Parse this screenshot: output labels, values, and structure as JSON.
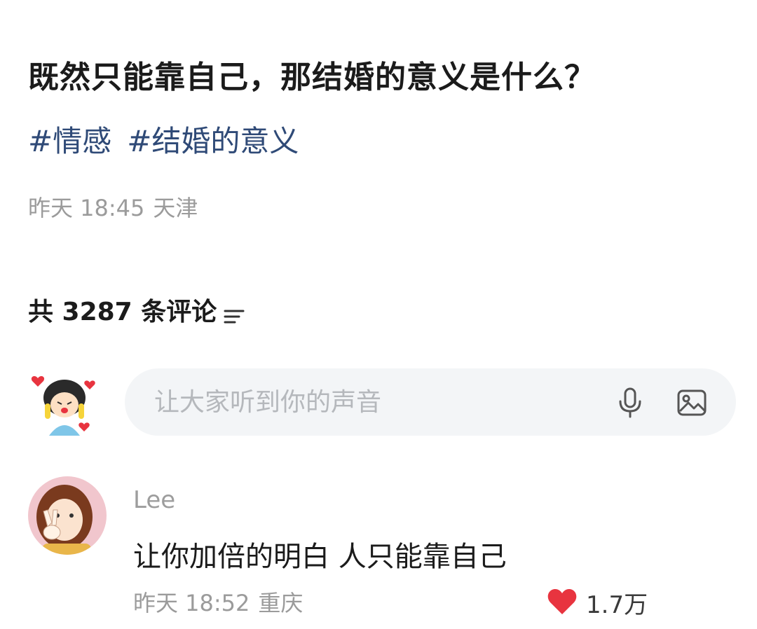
{
  "post": {
    "title": "既然只能靠自己，那结婚的意义是什么？",
    "tags": [
      "#情感",
      "#结婚的意义"
    ],
    "time": "昨天 18:45",
    "location": "天津"
  },
  "comments_header": {
    "label": "共 3287 条评论",
    "sort_icon": "sort-icon"
  },
  "composer": {
    "placeholder": "让大家听到你的声音",
    "mic_icon": "microphone-icon",
    "image_icon": "image-icon"
  },
  "comments": [
    {
      "author": "Lee",
      "text": "让你加倍的明白 人只能靠自己",
      "time": "昨天 18:52",
      "location": "重庆",
      "likes": "1.7万",
      "like_icon": "heart-icon"
    }
  ],
  "colors": {
    "tag": "#2f4a77",
    "meta": "#9b9b9b",
    "input_bg": "#f3f5f7",
    "heart": "#e8343f"
  }
}
